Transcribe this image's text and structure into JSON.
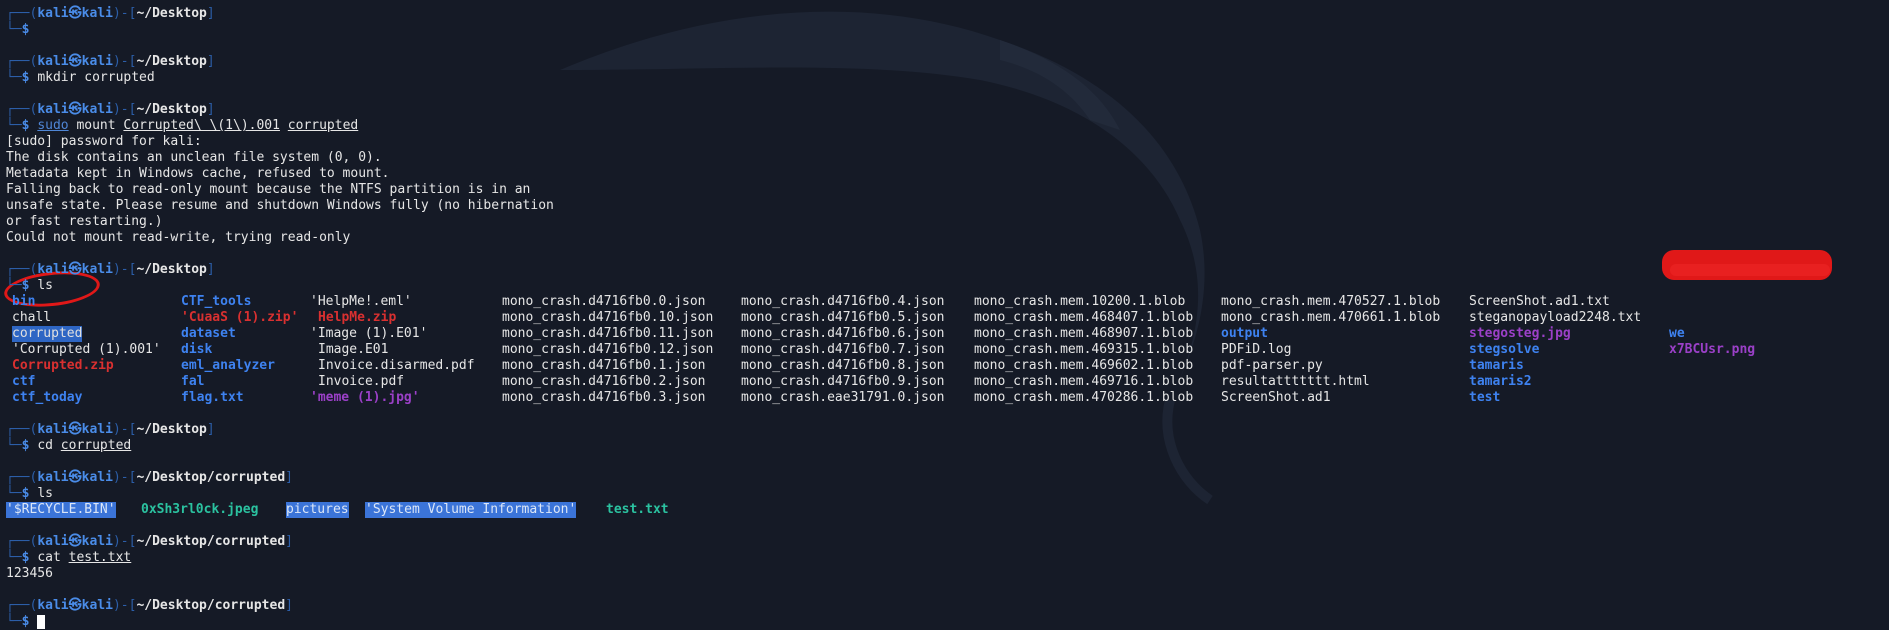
{
  "colors": {
    "background": "#151a26",
    "prompt_frame": "#2c5ea8",
    "directory": "#3e82f0",
    "archive": "#d93030",
    "image": "#9b40c8",
    "highlight": "#2e66c4"
  },
  "prompt": {
    "user": "kali",
    "host": "kali",
    "symbol": "$"
  },
  "block1": {
    "path": "~/Desktop"
  },
  "block2": {
    "path": "~/Desktop",
    "command": "mkdir corrupted"
  },
  "block3": {
    "path": "~/Desktop",
    "cmd_sudo": "sudo",
    "cmd_mount": "mount",
    "arg_image": "Corrupted\\ \\(1\\).001",
    "arg_target": "corrupted",
    "output": [
      "[sudo] password for kali:",
      "The disk contains an unclean file system (0, 0).",
      "Metadata kept in Windows cache, refused to mount.",
      "Falling back to read-only mount because the NTFS partition is in an",
      "unsafe state. Please resume and shutdown Windows fully (no hibernation",
      "or fast restarting.)",
      "Could not mount read-write, trying read-only"
    ]
  },
  "block4": {
    "path": "~/Desktop",
    "command": "ls",
    "rows": [
      [
        "bin",
        "CTF_tools",
        "'HelpMe!.eml'",
        "mono_crash.d4716fb0.0.json",
        "mono_crash.d4716fb0.4.json",
        "mono_crash.mem.10200.1.blob",
        "mono_crash.mem.470527.1.blob",
        "ScreenShot.ad1.txt",
        ""
      ],
      [
        "chall",
        "'CuaaS (1).zip'",
        "HelpMe.zip",
        "mono_crash.d4716fb0.10.json",
        "mono_crash.d4716fb0.5.json",
        "mono_crash.mem.468407.1.blob",
        "mono_crash.mem.470661.1.blob",
        "steganopayload2248.txt",
        ""
      ],
      [
        "corrupted",
        "dataset",
        "'Image (1).E01'",
        "mono_crash.d4716fb0.11.json",
        "mono_crash.d4716fb0.6.json",
        "mono_crash.mem.468907.1.blob",
        "output",
        "stegosteg.jpg",
        "we"
      ],
      [
        "'Corrupted (1).001'",
        "disk",
        "Image.E01",
        "mono_crash.d4716fb0.12.json",
        "mono_crash.d4716fb0.7.json",
        "mono_crash.mem.469315.1.blob",
        "PDFiD.log",
        "stegsolve",
        "x7BCUsr.png"
      ],
      [
        "Corrupted.zip",
        "eml_analyzer",
        "Invoice.disarmed.pdf",
        "mono_crash.d4716fb0.1.json",
        "mono_crash.d4716fb0.8.json",
        "mono_crash.mem.469602.1.blob",
        "pdf-parser.py",
        "tamaris",
        ""
      ],
      [
        "ctf",
        "fal",
        "Invoice.pdf",
        "mono_crash.d4716fb0.2.json",
        "mono_crash.d4716fb0.9.json",
        "mono_crash.mem.469716.1.blob",
        "resultattttttt.html",
        "tamaris2",
        ""
      ],
      [
        "ctf_today",
        "flag.txt",
        "'meme (1).jpg'",
        "mono_crash.d4716fb0.3.json",
        "mono_crash.eae31791.0.json",
        "mono_crash.mem.470286.1.blob",
        "ScreenShot.ad1",
        "test",
        ""
      ]
    ]
  },
  "block5": {
    "path": "~/Desktop",
    "command": "cd",
    "arg": "corrupted"
  },
  "block6": {
    "path": "~/Desktop/corrupted",
    "command": "ls",
    "items": [
      "'$RECYCLE.BIN'",
      "0xSh3rl0ck.jpeg",
      "pictures",
      "'System Volume Information'",
      "test.txt"
    ]
  },
  "block7": {
    "path": "~/Desktop/corrupted",
    "command": "cat",
    "arg": "test.txt",
    "output": "123456"
  },
  "block8": {
    "path": "~/Desktop/corrupted"
  }
}
